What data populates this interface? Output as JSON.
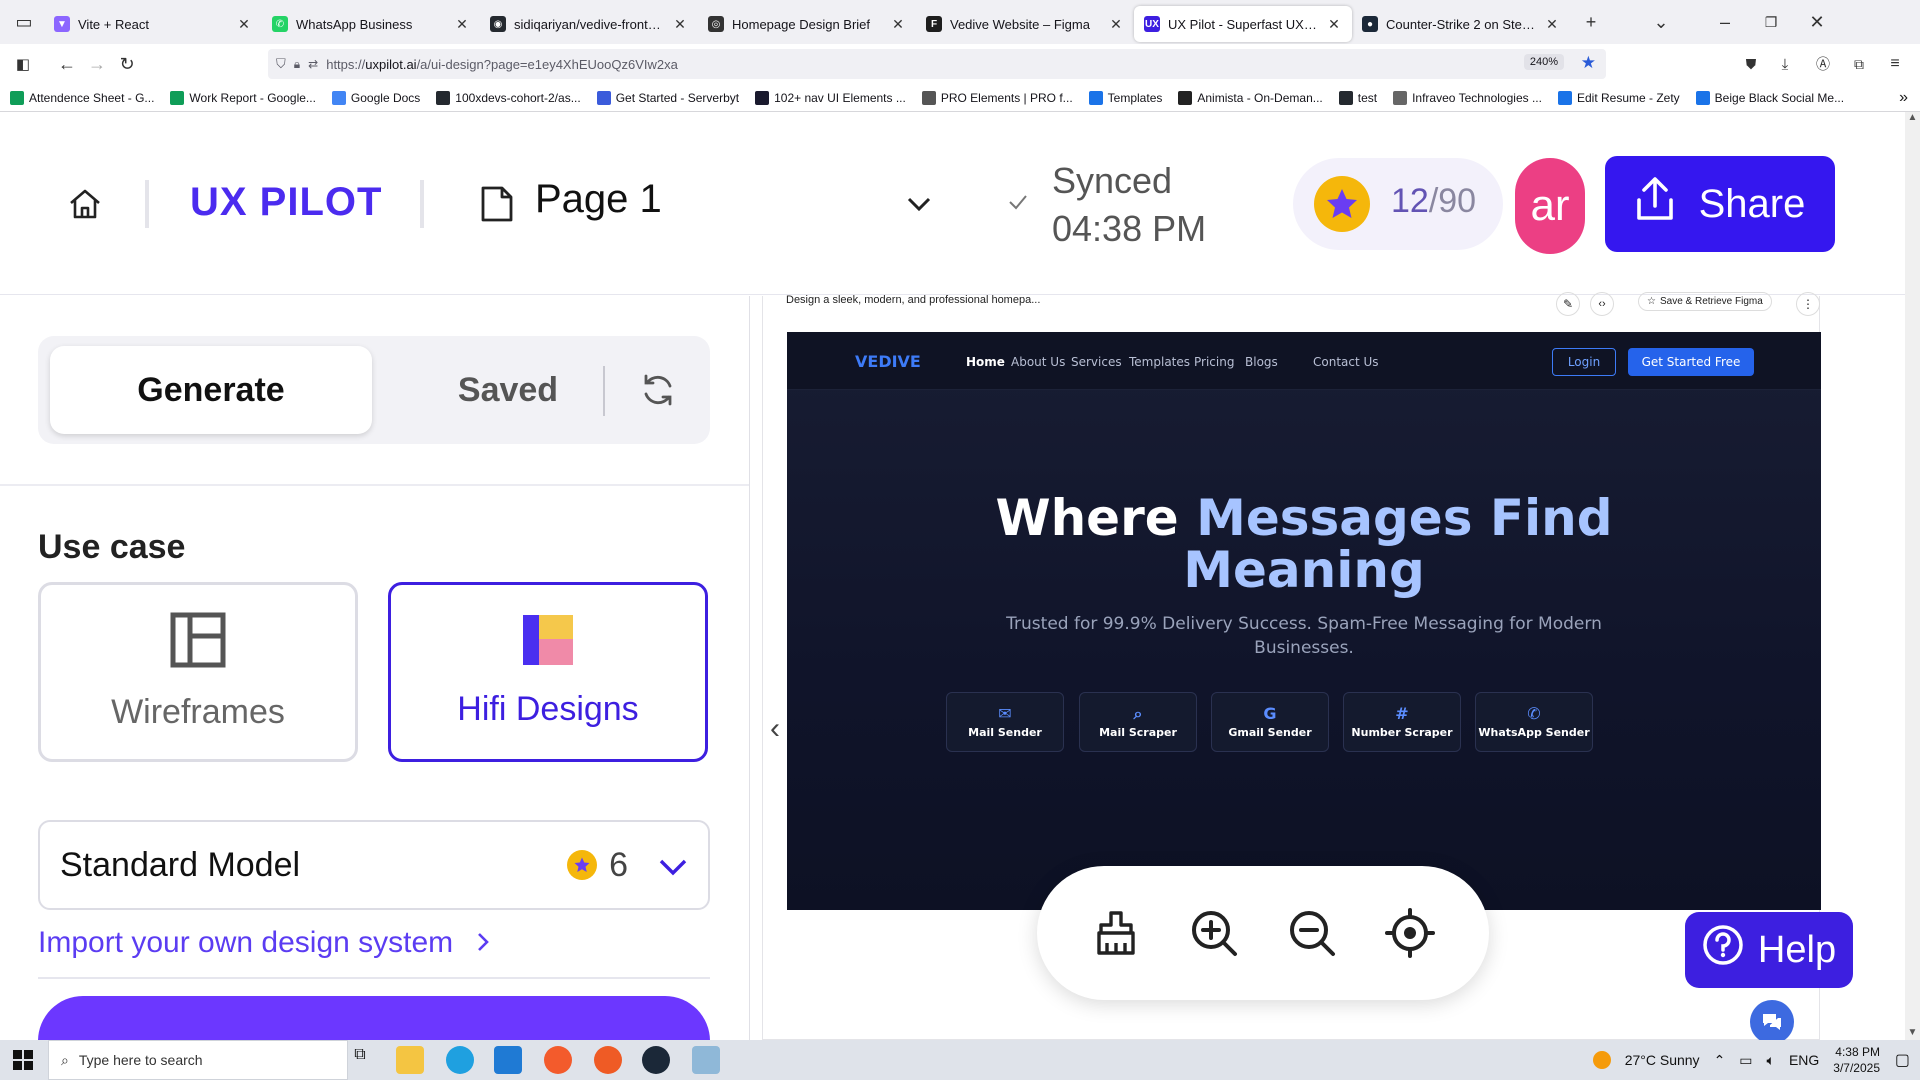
{
  "browser": {
    "tabs": [
      {
        "title": "Vite + React",
        "fav": "#8c66ff",
        "glyph": "▼",
        "active": false
      },
      {
        "title": "WhatsApp Business",
        "fav": "#25d366",
        "glyph": "✆",
        "active": false
      },
      {
        "title": "sidiqariyan/vedive-frontend at r",
        "fav": "#24292f",
        "glyph": "◉",
        "active": false
      },
      {
        "title": "Homepage Design Brief",
        "fav": "#333",
        "glyph": "◎",
        "active": false
      },
      {
        "title": "Vedive Website – Figma",
        "fav": "#1e1e1e",
        "glyph": "F",
        "active": false
      },
      {
        "title": "UX Pilot - Superfast UX/UI Desi",
        "fav": "#3d1fe0",
        "glyph": "UX",
        "active": true
      },
      {
        "title": "Counter-Strike 2 on Steam",
        "fav": "#1b2838",
        "glyph": "●",
        "active": false
      }
    ],
    "url_prefix": "https://",
    "url_domain": "uxpilot.ai",
    "url_path": "/a/ui-design?page=e1ey4XhEUooQz6VIw2xa",
    "zoom": "240%",
    "bookmarks": [
      {
        "label": "Attendence Sheet - G...",
        "color": "#0f9d58"
      },
      {
        "label": "Work Report - Google...",
        "color": "#0f9d58"
      },
      {
        "label": "Google Docs",
        "color": "#4285f4"
      },
      {
        "label": "100xdevs-cohort-2/as...",
        "color": "#24292f"
      },
      {
        "label": "Get Started - Serverbyt",
        "color": "#3b5bdb"
      },
      {
        "label": "102+ nav UI Elements ...",
        "color": "#1a1a2e"
      },
      {
        "label": "PRO Elements | PRO f...",
        "color": "#555"
      },
      {
        "label": "Templates",
        "color": "#1a73e8"
      },
      {
        "label": "Animista - On-Deman...",
        "color": "#222"
      },
      {
        "label": "test",
        "color": "#24292f"
      },
      {
        "label": "Infraveo Technologies ...",
        "color": "#666"
      },
      {
        "label": "Edit Resume - Zety",
        "color": "#1a73e8"
      },
      {
        "label": "Beige Black Social Me...",
        "color": "#1a73e8"
      }
    ]
  },
  "header": {
    "logo": "UX PILOT",
    "page_name": "Page 1",
    "sync_status": "Synced",
    "sync_time": "04:38 PM",
    "credits_used": "12",
    "credits_total": "/90",
    "avatar_initials": "ar",
    "share_label": "Share"
  },
  "left_panel": {
    "tab_generate": "Generate",
    "tab_saved": "Saved",
    "use_case_title": "Use case",
    "card_wireframes": "Wireframes",
    "card_hifi": "Hifi Designs",
    "model_label": "Standard Model",
    "model_cost": "6",
    "import_link": "Import your own design system"
  },
  "canvas": {
    "frame_prompt": "Design a sleek, modern, and professional homepa...",
    "save_retrieve": "Save & Retrieve Figma",
    "preview": {
      "logo": "VEDIVE",
      "nav_links": [
        "Home",
        "About Us",
        "Services",
        "Templates",
        "Pricing",
        "Blogs",
        "Contact Us"
      ],
      "login": "Login",
      "cta": "Get Started Free",
      "title_1": "Where ",
      "title_2": "Messages Find",
      "title_3": "Meaning",
      "subtitle": "Trusted for 99.9% Delivery Success. Spam-Free Messaging for Modern Businesses.",
      "features": [
        {
          "icon": "✉",
          "label": "Mail Sender"
        },
        {
          "icon": "⌕",
          "label": "Mail Scraper"
        },
        {
          "icon": "G",
          "label": "Gmail Sender"
        },
        {
          "icon": "#",
          "label": "Number Scraper"
        },
        {
          "icon": "✆",
          "label": "WhatsApp Sender"
        }
      ]
    },
    "help_label": "Help"
  },
  "taskbar": {
    "search_placeholder": "Type here to search",
    "weather": "27°C  Sunny",
    "lang": "ENG",
    "time": "4:38 PM",
    "date": "3/7/2025"
  },
  "colors": {
    "brand": "#3d1fe0",
    "share": "#3517ef",
    "avatar": "#ec3f84",
    "coin": "#f5b70b"
  }
}
